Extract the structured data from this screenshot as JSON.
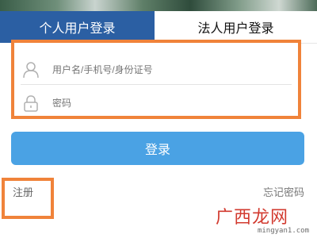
{
  "tabs": {
    "personal": "个人用户登录",
    "legal": "法人用户登录"
  },
  "form": {
    "username_placeholder": "用户名/手机号/身份证号",
    "password_placeholder": "密码",
    "user_icon": "user-icon",
    "lock_icon": "lock-icon"
  },
  "actions": {
    "login": "登录",
    "register": "注册",
    "forgot_password": "忘记密码"
  },
  "watermark": {
    "chinese": "广西龙网",
    "url": "mingyan1.com"
  },
  "colors": {
    "active_tab": "#2b5fa3",
    "login_button": "#4aa2e4",
    "highlight": "#f0833a",
    "watermark": "#d23a2f"
  }
}
